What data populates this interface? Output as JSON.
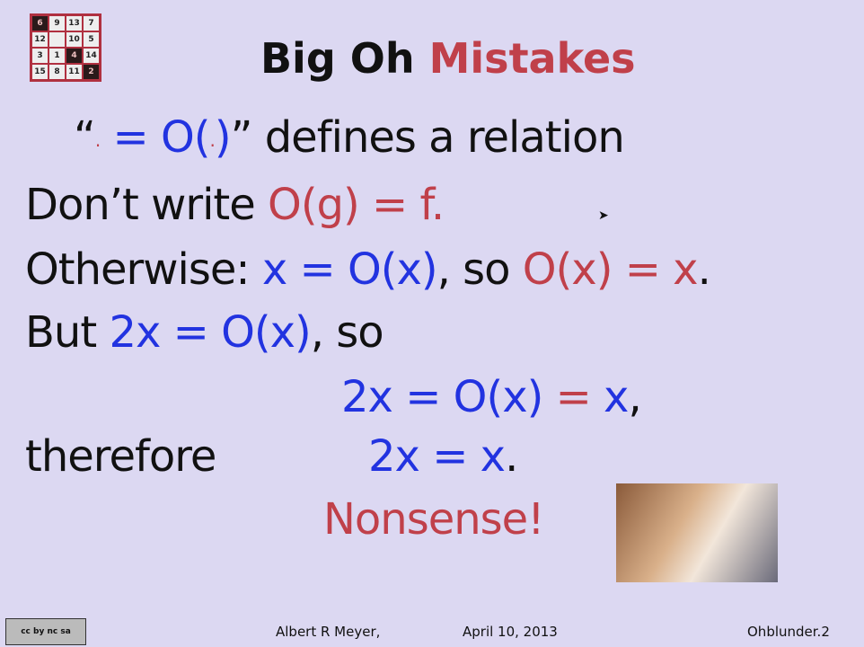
{
  "puzzle": {
    "cells": [
      "6",
      "9",
      "13",
      "7",
      "12",
      "",
      "10",
      "5",
      "3",
      "1",
      "4",
      "14",
      "15",
      "8",
      "11",
      "2"
    ],
    "dark": [
      0,
      10,
      15
    ]
  },
  "title": {
    "black": "Big Oh",
    "red": "Mistakes"
  },
  "lines": {
    "l1": {
      "q1": "“",
      "dot1": "·",
      "eq": " = O(",
      "dot2": "·",
      "close": ")",
      "rest": "” defines a relation"
    },
    "l2": {
      "a": "Don’t write ",
      "b": "O(g) = f."
    },
    "l3": {
      "a": "Otherwise: ",
      "b": "x = O(x)",
      "c": ", so ",
      "d": "O(x) = x",
      "e": "."
    },
    "l4": {
      "a": "But ",
      "b": "2x = O(x)",
      "c": ", so"
    },
    "l5": {
      "a": "2x = O(x) ",
      "b": "=",
      "c": " x",
      "d": ","
    },
    "l6": {
      "a": "therefore",
      "b": "2x = x",
      "c": "."
    },
    "l7": "Nonsense!"
  },
  "footer": {
    "license": "cc by nc sa",
    "author": "Albert R Meyer,",
    "date": "April 10, 2013",
    "slide_id": "Ohblunder.2"
  },
  "colors": {
    "background": "#dcd8f2",
    "blue": "#2233e0",
    "red": "#c0404a"
  }
}
